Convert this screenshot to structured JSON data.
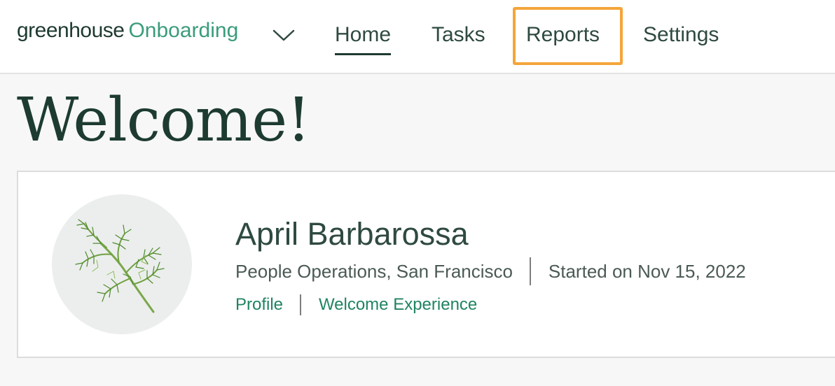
{
  "brand": {
    "name": "greenhouse",
    "product": "Onboarding"
  },
  "nav": {
    "items": [
      {
        "label": "Home",
        "active": true
      },
      {
        "label": "Tasks",
        "active": false
      },
      {
        "label": "Reports",
        "active": false,
        "highlighted": true
      },
      {
        "label": "Settings",
        "active": false
      }
    ]
  },
  "page": {
    "title": "Welcome!"
  },
  "profile": {
    "name": "April Barbarossa",
    "department_location": "People Operations, San Francisco",
    "started": "Started on Nov 15, 2022",
    "links": [
      "Profile",
      "Welcome Experience"
    ],
    "avatar_icon": "dill-sprig-icon"
  },
  "colors": {
    "brand_dark": "#1e3a31",
    "brand_accent": "#3a9c7a",
    "link": "#1f8462",
    "highlight_outline": "#f4a53a",
    "background": "#f7f7f7"
  }
}
